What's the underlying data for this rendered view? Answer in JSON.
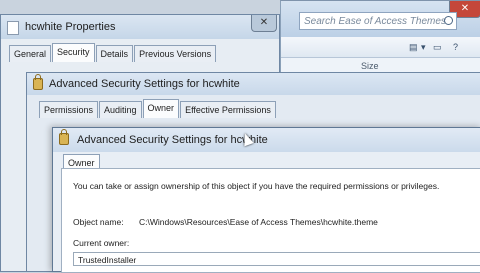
{
  "explorer": {
    "search_placeholder": "Search Ease of Access Themes",
    "column_size": "Size",
    "view_icon": "view-icon"
  },
  "props_window": {
    "title": "hcwhite Properties",
    "tabs": [
      "General",
      "Security",
      "Details",
      "Previous Versions"
    ]
  },
  "adv_window_1": {
    "title": "Advanced Security Settings for hcwhite",
    "tabs": [
      "Permissions",
      "Auditing",
      "Owner",
      "Effective Permissions"
    ]
  },
  "adv_window_2": {
    "title": "Advanced Security Settings for hcwhite",
    "tab": "Owner",
    "description": "You can take or assign ownership of this object if you have the required permissions or privileges.",
    "object_name_label": "Object name:",
    "object_name_value": "C:\\Windows\\Resources\\Ease of Access Themes\\hcwhite.theme",
    "current_owner_label": "Current owner:",
    "current_owner_value": "TrustedInstaller"
  }
}
